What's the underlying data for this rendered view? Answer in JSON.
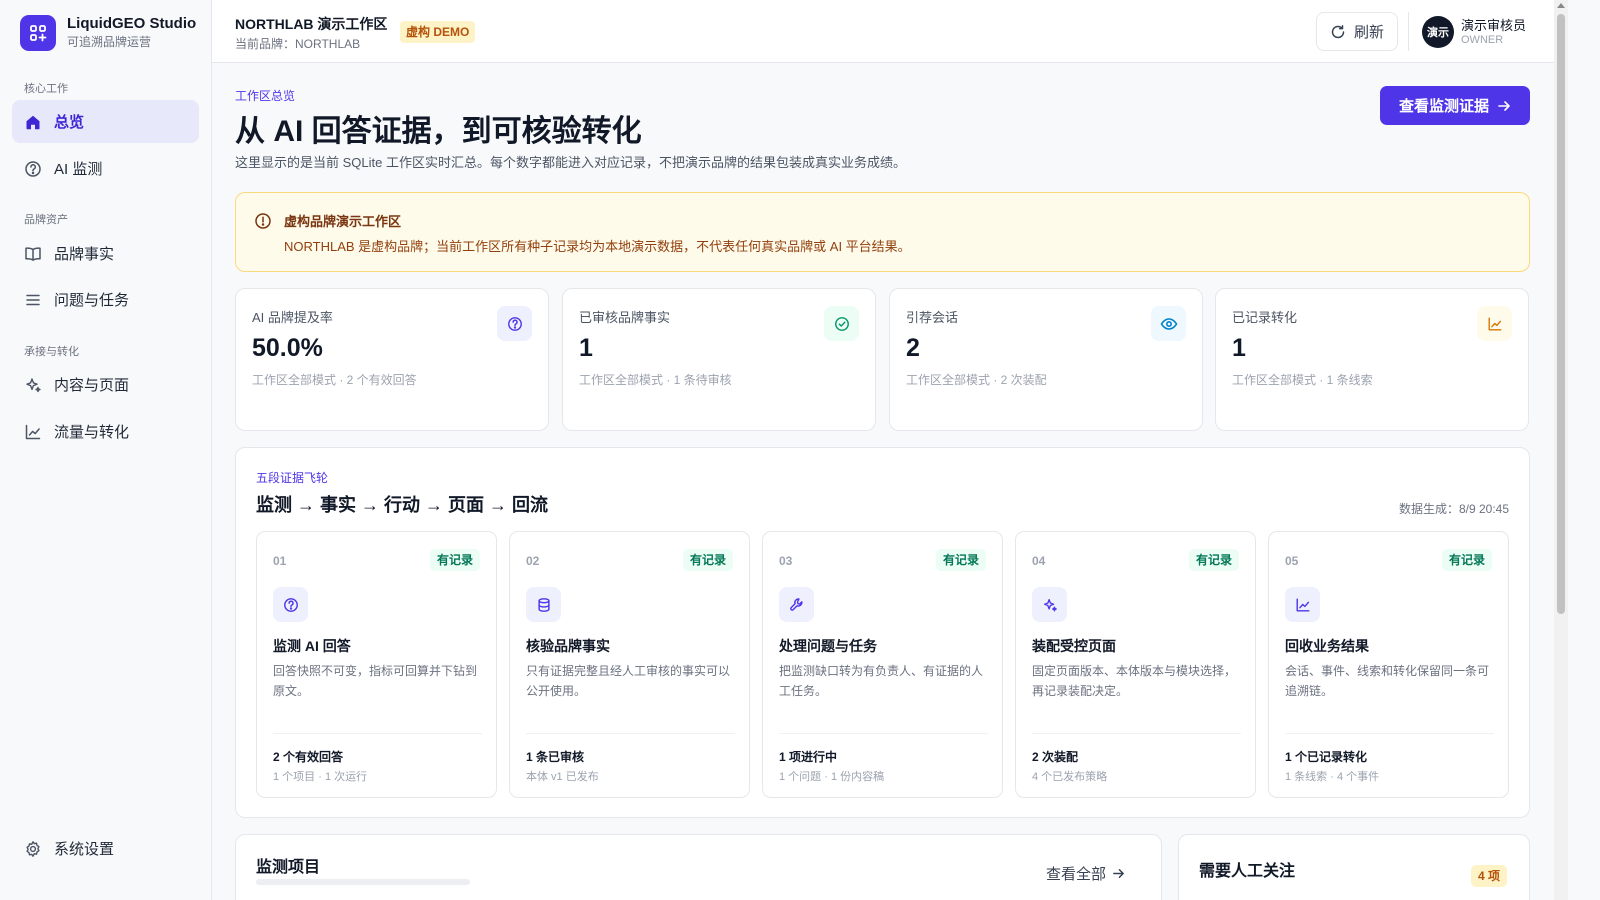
{
  "app": {
    "name": "LiquidGEO Studio",
    "tagline": "可追溯品牌运营"
  },
  "sidebar": {
    "sections": [
      {
        "label": "核心工作"
      },
      {
        "label": "品牌资产"
      },
      {
        "label": "承接与转化"
      }
    ],
    "items": [
      {
        "label": "总览",
        "icon": "home-icon",
        "active": true
      },
      {
        "label": "AI 监测",
        "icon": "question-circle-icon"
      },
      {
        "label": "品牌事实",
        "icon": "book-icon"
      },
      {
        "label": "问题与任务",
        "icon": "list-icon"
      },
      {
        "label": "内容与页面",
        "icon": "sparkle-icon"
      },
      {
        "label": "流量与转化",
        "icon": "trend-chart-icon"
      }
    ],
    "settings_label": "系统设置"
  },
  "header": {
    "workspace_title": "NORTHLAB 演示工作区",
    "brand_line": "当前品牌：NORTHLAB",
    "demo_badge": "虚构 DEMO",
    "refresh_label": "刷新",
    "user": {
      "avatar_text": "演示",
      "name": "演示审核员",
      "role": "OWNER"
    }
  },
  "hero": {
    "eyebrow": "工作区总览",
    "title": "从 AI 回答证据，到可核验转化",
    "description": "这里显示的是当前 SQLite 工作区实时汇总。每个数字都能进入对应记录，不把演示品牌的结果包装成真实业务成绩。",
    "cta_label": "查看监测证据"
  },
  "notice": {
    "title": "虚构品牌演示工作区",
    "text": "NORTHLAB 是虚构品牌；当前工作区所有种子记录均为本地演示数据，不代表任何真实品牌或 AI 平台结果。"
  },
  "stats": [
    {
      "label": "AI 品牌提及率",
      "value": "50.0%",
      "sub": "工作区全部模式 · 2 个有效回答",
      "icon": "question-circle-icon",
      "color": "#4f35e8",
      "bg": "#eef0fd"
    },
    {
      "label": "已审核品牌事实",
      "value": "1",
      "sub": "工作区全部模式 · 1 条待审核",
      "icon": "check-circle-icon",
      "color": "#059669",
      "bg": "#ecfdf5"
    },
    {
      "label": "引荐会话",
      "value": "2",
      "sub": "工作区全部模式 · 2 次装配",
      "icon": "eye-icon",
      "color": "#0284c7",
      "bg": "#eff8ff"
    },
    {
      "label": "已记录转化",
      "value": "1",
      "sub": "工作区全部模式 · 1 条线索",
      "icon": "trend-chart-icon",
      "color": "#d97706",
      "bg": "#fffbeb"
    }
  ],
  "flywheel": {
    "eyebrow": "五段证据飞轮",
    "title": "监测 → 事实 → 行动 → 页面 → 回流",
    "generated": "数据生成：8/9 20:45",
    "steps": [
      {
        "num": "01",
        "badge": "有记录",
        "icon": "question-circle-icon",
        "title": "监测 AI 回答",
        "desc": "回答快照不可变，指标可回算并下钻到原文。",
        "metric": "2 个有效回答",
        "metric_sub": "1 个项目 · 1 次运行"
      },
      {
        "num": "02",
        "badge": "有记录",
        "icon": "database-icon",
        "title": "核验品牌事实",
        "desc": "只有证据完整且经人工审核的事实可以公开使用。",
        "metric": "1 条已审核",
        "metric_sub": "本体 v1 已发布"
      },
      {
        "num": "03",
        "badge": "有记录",
        "icon": "wrench-icon",
        "title": "处理问题与任务",
        "desc": "把监测缺口转为有负责人、有证据的人工任务。",
        "metric": "1 项进行中",
        "metric_sub": "1 个问题 · 1 份内容稿"
      },
      {
        "num": "04",
        "badge": "有记录",
        "icon": "sparkle-icon",
        "title": "装配受控页面",
        "desc": "固定页面版本、本体版本与模块选择，再记录装配决定。",
        "metric": "2 次装配",
        "metric_sub": "4 个已发布策略"
      },
      {
        "num": "05",
        "badge": "有记录",
        "icon": "trend-chart-icon",
        "title": "回收业务结果",
        "desc": "会话、事件、线索和转化保留同一条可追溯链。",
        "metric": "1 个已记录转化",
        "metric_sub": "1 条线索 · 4 个事件"
      }
    ]
  },
  "bottom": {
    "monitor_title": "监测项目",
    "monitor_link": "查看全部",
    "attention_title": "需要人工关注",
    "attention_count": "4 项"
  }
}
